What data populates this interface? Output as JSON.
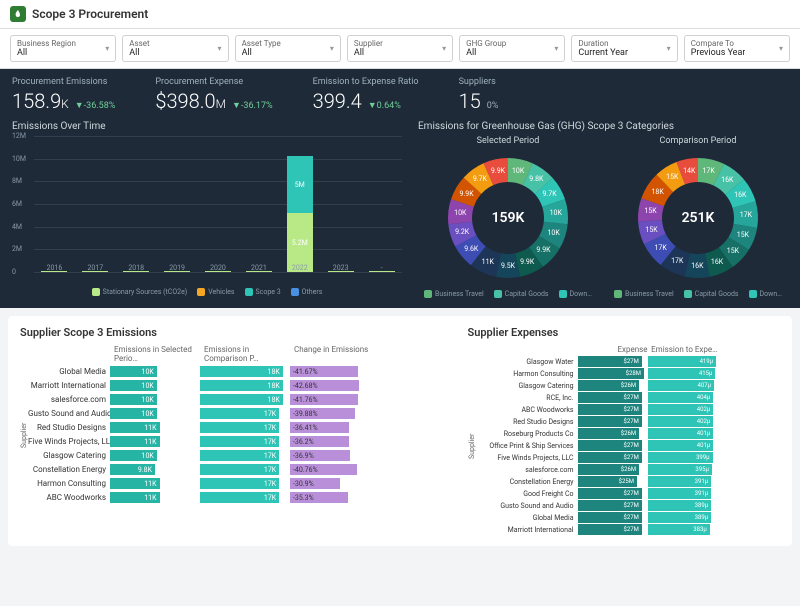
{
  "header": {
    "title": "Scope 3 Procurement"
  },
  "filters": [
    {
      "label": "Business Region",
      "value": "All"
    },
    {
      "label": "Asset",
      "value": "All"
    },
    {
      "label": "Asset Type",
      "value": "All"
    },
    {
      "label": "Supplier",
      "value": "All"
    },
    {
      "label": "GHG Group",
      "value": "All"
    },
    {
      "label": "Duration",
      "value": "Current Year"
    },
    {
      "label": "Compare To",
      "value": "Previous Year"
    }
  ],
  "kpis": {
    "emissions": {
      "label": "Procurement Emissions",
      "value": "158.9",
      "unit": "K",
      "delta": "▼-36.58%"
    },
    "expense": {
      "label": "Procurement Expense",
      "value": "$398.0",
      "unit": "M",
      "delta": "▼-36.17%"
    },
    "ratio": {
      "label": "Emission to Expense Ratio",
      "value": "399.4",
      "unit": "",
      "delta": "▼0.64%"
    },
    "suppliers": {
      "label": "Suppliers",
      "value": "15",
      "unit": "",
      "delta": "0%"
    }
  },
  "emissions_over_time": {
    "title": "Emissions Over Time",
    "legend": [
      "Stationary Sources (tCO2e)",
      "Vehicles",
      "Scope 3",
      "Others"
    ],
    "colors": [
      "#b8e986",
      "#f5a623",
      "#2ec4b6",
      "#4a90e2"
    ]
  },
  "ghg": {
    "title": "Emissions for Greenhouse Gas (GHG) Scope 3 Categories",
    "selected": {
      "title": "Selected Period",
      "center": "159K"
    },
    "comparison": {
      "title": "Comparison Period",
      "center": "251K"
    },
    "legend": [
      "Business Travel",
      "Capital Goods",
      "Down…"
    ]
  },
  "tables": {
    "left": {
      "title": "Supplier Scope 3 Emissions",
      "headers": [
        "Emissions in Selected Perio…",
        "Emissions in Comparison P…",
        "Change in Emissions"
      ],
      "axis": "Supplier"
    },
    "right": {
      "title": "Supplier Expenses",
      "headers": [
        "Expense",
        "Emission to Expe…"
      ],
      "axis": "Supplier"
    }
  },
  "chart_data": {
    "emissions_over_time": {
      "type": "bar",
      "stacked": true,
      "ylabel": "",
      "ylim": [
        0,
        12000000
      ],
      "yticks": [
        "0",
        "2M",
        "4M",
        "6M",
        "8M",
        "10M",
        "12M"
      ],
      "categories": [
        "2016",
        "2017",
        "2018",
        "2019",
        "2020",
        "2021",
        "2022",
        "2023",
        "-"
      ],
      "series": [
        {
          "name": "Stationary Sources (tCO2e)",
          "color": "#b8e986",
          "values": [
            80000,
            80000,
            80000,
            80000,
            80000,
            80000,
            5200000,
            80000,
            80000
          ]
        },
        {
          "name": "Scope 3",
          "color": "#2ec4b6",
          "values": [
            0,
            0,
            0,
            0,
            0,
            0,
            5000000,
            0,
            0
          ]
        }
      ],
      "data_labels": {
        "2022": [
          "5.2M",
          "5M"
        ]
      }
    },
    "ghg_donuts": [
      {
        "type": "pie",
        "title": "Selected Period",
        "center": "159K",
        "slices": [
          {
            "label": "10K",
            "value": 10,
            "color": "#5fb77a"
          },
          {
            "label": "9.8K",
            "value": 9.8,
            "color": "#47c2a7"
          },
          {
            "label": "9.7K",
            "value": 9.7,
            "color": "#2ec4b6"
          },
          {
            "label": "10K",
            "value": 10,
            "color": "#26a59a"
          },
          {
            "label": "10K",
            "value": 10,
            "color": "#1e857e"
          },
          {
            "label": "9.9K",
            "value": 9.9,
            "color": "#167066"
          },
          {
            "label": "9.9K",
            "value": 9.9,
            "color": "#0e5a4f"
          },
          {
            "label": "9.5K",
            "value": 9.5,
            "color": "#15455a"
          },
          {
            "label": "11K",
            "value": 11,
            "color": "#1d3557"
          },
          {
            "label": "9.6K",
            "value": 9.6,
            "color": "#3d4db3"
          },
          {
            "label": "9.2K",
            "value": 9.2,
            "color": "#6a4fc1"
          },
          {
            "label": "10K",
            "value": 10,
            "color": "#8e44ad"
          },
          {
            "label": "9.9K",
            "value": 9.9,
            "color": "#d35400"
          },
          {
            "label": "9.7K",
            "value": 9.7,
            "color": "#f39c12"
          },
          {
            "label": "9.9K",
            "value": 9.9,
            "color": "#e74c3c"
          }
        ]
      },
      {
        "type": "pie",
        "title": "Comparison Period",
        "center": "251K",
        "slices": [
          {
            "label": "17K",
            "value": 17,
            "color": "#5fb77a"
          },
          {
            "label": "16K",
            "value": 16,
            "color": "#47c2a7"
          },
          {
            "label": "16K",
            "value": 16,
            "color": "#2ec4b6"
          },
          {
            "label": "17K",
            "value": 17,
            "color": "#26a59a"
          },
          {
            "label": "15K",
            "value": 15,
            "color": "#1e857e"
          },
          {
            "label": "15K",
            "value": 15,
            "color": "#167066"
          },
          {
            "label": "16K",
            "value": 16,
            "color": "#0e5a4f"
          },
          {
            "label": "16K",
            "value": 16,
            "color": "#15455a"
          },
          {
            "label": "17K",
            "value": 17,
            "color": "#1d3557"
          },
          {
            "label": "17K",
            "value": 17,
            "color": "#3d4db3"
          },
          {
            "label": "15K",
            "value": 15,
            "color": "#6a4fc1"
          },
          {
            "label": "15K",
            "value": 15,
            "color": "#8e44ad"
          },
          {
            "label": "18K",
            "value": 18,
            "color": "#d35400"
          },
          {
            "label": "15K",
            "value": 15,
            "color": "#f39c12"
          },
          {
            "label": "14K",
            "value": 14,
            "color": "#e74c3c"
          }
        ]
      }
    ],
    "supplier_emissions": {
      "type": "table",
      "columns": [
        "Supplier",
        "Emissions in Selected Period",
        "Emissions in Comparison Period",
        "Change in Emissions"
      ],
      "rows": [
        {
          "name": "Global Media",
          "sel": "10K",
          "cmp": "18K",
          "chg": "-41.67%",
          "selW": 52,
          "cmpW": 92,
          "chgW": 75
        },
        {
          "name": "Marriott International",
          "sel": "10K",
          "cmp": "18K",
          "chg": "-42.68%",
          "selW": 52,
          "cmpW": 92,
          "chgW": 77
        },
        {
          "name": "salesforce.com",
          "sel": "10K",
          "cmp": "18K",
          "chg": "-41.76%",
          "selW": 52,
          "cmpW": 92,
          "chgW": 75
        },
        {
          "name": "Gusto Sound and Audio",
          "sel": "10K",
          "cmp": "17K",
          "chg": "-39.88%",
          "selW": 52,
          "cmpW": 88,
          "chgW": 72
        },
        {
          "name": "Red Studio Designs",
          "sel": "11K",
          "cmp": "17K",
          "chg": "-36.41%",
          "selW": 55,
          "cmpW": 88,
          "chgW": 66
        },
        {
          "name": "Five Winds Projects, LLC",
          "sel": "11K",
          "cmp": "17K",
          "chg": "-36.2%",
          "selW": 55,
          "cmpW": 88,
          "chgW": 65
        },
        {
          "name": "Glasgow Catering",
          "sel": "10K",
          "cmp": "17K",
          "chg": "-36.9%",
          "selW": 52,
          "cmpW": 88,
          "chgW": 67
        },
        {
          "name": "Constellation Energy",
          "sel": "9.8K",
          "cmp": "17K",
          "chg": "-40.76%",
          "selW": 50,
          "cmpW": 88,
          "chgW": 74
        },
        {
          "name": "Harmon Consulting",
          "sel": "11K",
          "cmp": "17K",
          "chg": "-30.9%",
          "selW": 55,
          "cmpW": 88,
          "chgW": 56
        },
        {
          "name": "ABC Woodworks",
          "sel": "11K",
          "cmp": "17K",
          "chg": "-35.3%",
          "selW": 55,
          "cmpW": 88,
          "chgW": 64
        }
      ]
    },
    "supplier_expenses": {
      "type": "table",
      "columns": [
        "Supplier",
        "Expense",
        "Emission to Expense"
      ],
      "rows": [
        {
          "name": "Glasgow Water",
          "exp": "$27M",
          "em": "419µ",
          "expW": 92,
          "emW": 98
        },
        {
          "name": "Harmon Consulting",
          "exp": "$28M",
          "em": "415µ",
          "expW": 95,
          "emW": 97
        },
        {
          "name": "Glasgow Catering",
          "exp": "$26M",
          "em": "407µ",
          "expW": 88,
          "emW": 95
        },
        {
          "name": "RCE, Inc.",
          "exp": "$27M",
          "em": "404µ",
          "expW": 92,
          "emW": 94
        },
        {
          "name": "ABC Woodworks",
          "exp": "$27M",
          "em": "402µ",
          "expW": 92,
          "emW": 94
        },
        {
          "name": "Red Studio Designs",
          "exp": "$27M",
          "em": "402µ",
          "expW": 92,
          "emW": 94
        },
        {
          "name": "Roseburg Products Co",
          "exp": "$26M",
          "em": "401µ",
          "expW": 88,
          "emW": 94
        },
        {
          "name": "Office Print & Ship Services",
          "exp": "$27M",
          "em": "401µ",
          "expW": 92,
          "emW": 94
        },
        {
          "name": "Five Winds Projects, LLC",
          "exp": "$27M",
          "em": "399µ",
          "expW": 92,
          "emW": 93
        },
        {
          "name": "salesforce.com",
          "exp": "$26M",
          "em": "395µ",
          "expW": 88,
          "emW": 92
        },
        {
          "name": "Constellation Energy",
          "exp": "$25M",
          "em": "391µ",
          "expW": 85,
          "emW": 91
        },
        {
          "name": "Good Freight Co",
          "exp": "$27M",
          "em": "391µ",
          "expW": 92,
          "emW": 91
        },
        {
          "name": "Gusto Sound and Audio",
          "exp": "$27M",
          "em": "389µ",
          "expW": 92,
          "emW": 91
        },
        {
          "name": "Global Media",
          "exp": "$27M",
          "em": "389µ",
          "expW": 92,
          "emW": 91
        },
        {
          "name": "Marriott International",
          "exp": "$27M",
          "em": "383µ",
          "expW": 92,
          "emW": 89
        }
      ]
    }
  }
}
